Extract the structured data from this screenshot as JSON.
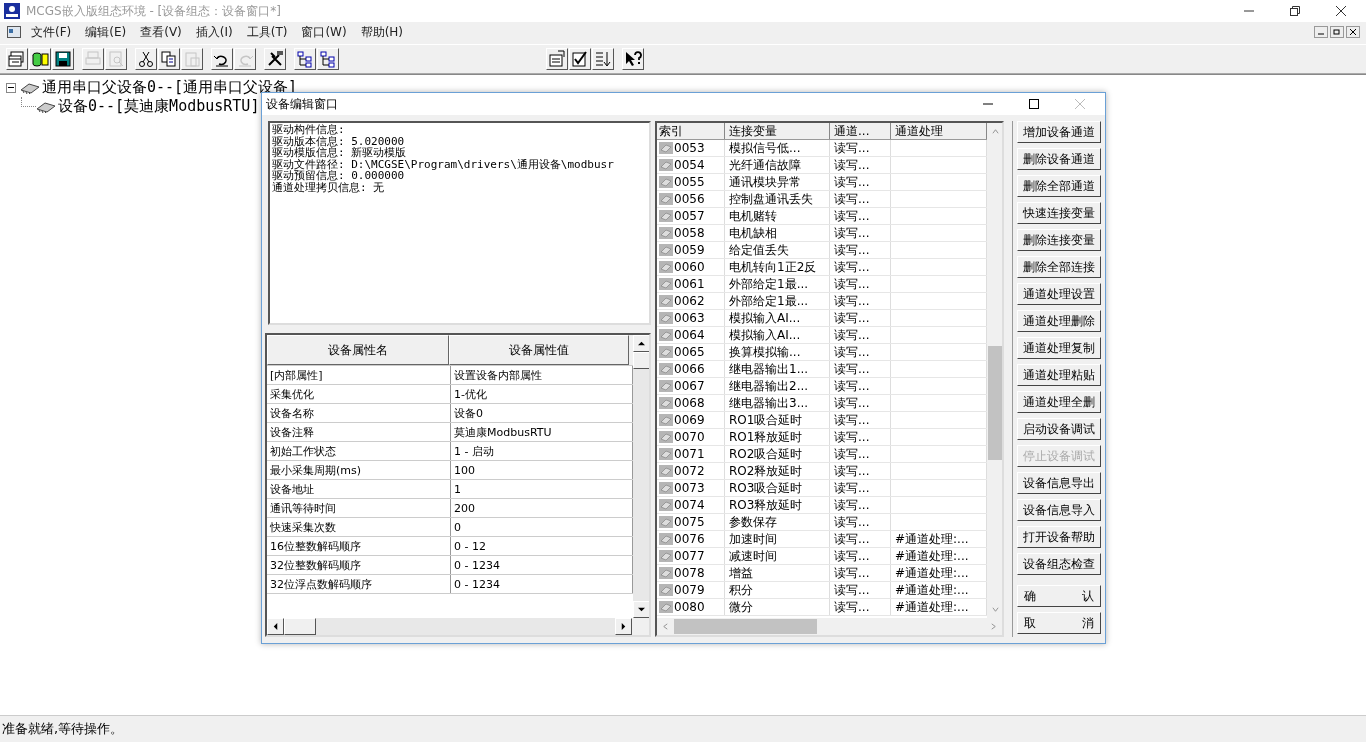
{
  "window": {
    "title": "MCGS嵌入版组态环境 - [设备组态：设备窗口*]"
  },
  "menu": [
    "文件(F)",
    "编辑(E)",
    "查看(V)",
    "插入(I)",
    "工具(T)",
    "窗口(W)",
    "帮助(H)"
  ],
  "toolbar_left": [
    [
      {
        "kind": "windows",
        "disabled": false
      },
      {
        "kind": "database",
        "disabled": false
      },
      {
        "kind": "save",
        "disabled": false
      }
    ],
    [
      {
        "kind": "print",
        "disabled": true
      },
      {
        "kind": "preview",
        "disabled": true
      }
    ],
    [
      {
        "kind": "cut",
        "disabled": false
      },
      {
        "kind": "copy",
        "disabled": false
      },
      {
        "kind": "paste",
        "disabled": true
      }
    ],
    [
      {
        "kind": "undo",
        "disabled": false
      },
      {
        "kind": "redo",
        "disabled": true
      }
    ],
    [
      {
        "kind": "tools",
        "disabled": false
      }
    ],
    [
      {
        "kind": "tree",
        "disabled": false
      },
      {
        "kind": "tree",
        "disabled": false
      }
    ]
  ],
  "toolbar_right": [
    [
      {
        "kind": "properties",
        "disabled": false
      },
      {
        "kind": "check",
        "disabled": false
      },
      {
        "kind": "sort",
        "disabled": false
      }
    ],
    [
      {
        "kind": "help",
        "disabled": false
      }
    ]
  ],
  "tree": {
    "label": "通用串口父设备0--[通用串口父设备]",
    "expanded": true,
    "children": [
      {
        "label": "设备0--[莫迪康ModbusRTU]"
      }
    ]
  },
  "dialog": {
    "title": "设备编辑窗口",
    "info_lines": [
      "驱动构件信息:",
      "驱动版本信息: 5.020000",
      "驱动模版信息: 新驱动模版",
      "驱动文件路径: D:\\MCGSE\\Program\\drivers\\通用设备\\modbusr",
      "驱动预留信息: 0.000000",
      "通道处理拷贝信息: 无"
    ],
    "properties": {
      "columns": [
        "设备属性名",
        "设备属性值"
      ],
      "rows": [
        {
          "name": "[内部属性]",
          "value": "设置设备内部属性"
        },
        {
          "name": "采集优化",
          "value": "1-优化"
        },
        {
          "name": "设备名称",
          "value": "设备0"
        },
        {
          "name": "设备注释",
          "value": "莫迪康ModbusRTU"
        },
        {
          "name": "初始工作状态",
          "value": "1 - 启动"
        },
        {
          "name": "最小采集周期(ms)",
          "value": "100"
        },
        {
          "name": "设备地址",
          "value": "1"
        },
        {
          "name": "通讯等待时间",
          "value": "200"
        },
        {
          "name": "快速采集次数",
          "value": "0"
        },
        {
          "name": "16位整数解码顺序",
          "value": "0 - 12"
        },
        {
          "name": "32位整数解码顺序",
          "value": "0 - 1234"
        },
        {
          "name": "32位浮点数解码顺序",
          "value": "0 - 1234"
        }
      ]
    },
    "channels": {
      "columns": [
        "索引",
        "连接变量",
        "通道...",
        "通道处理"
      ],
      "rows": [
        {
          "index": "0053",
          "variable": "模拟信号低...",
          "type": "读写...",
          "processing": ""
        },
        {
          "index": "0054",
          "variable": "光纤通信故障",
          "type": "读写...",
          "processing": ""
        },
        {
          "index": "0055",
          "variable": "通讯模块异常",
          "type": "读写...",
          "processing": ""
        },
        {
          "index": "0056",
          "variable": "控制盘通讯丢失",
          "type": "读写...",
          "processing": ""
        },
        {
          "index": "0057",
          "variable": "电机赌转",
          "type": "读写...",
          "processing": ""
        },
        {
          "index": "0058",
          "variable": "电机缺相",
          "type": "读写...",
          "processing": ""
        },
        {
          "index": "0059",
          "variable": "给定值丢失",
          "type": "读写...",
          "processing": ""
        },
        {
          "index": "0060",
          "variable": "电机转向1正2反",
          "type": "读写...",
          "processing": ""
        },
        {
          "index": "0061",
          "variable": "外部给定1最...",
          "type": "读写...",
          "processing": ""
        },
        {
          "index": "0062",
          "variable": "外部给定1最...",
          "type": "读写...",
          "processing": ""
        },
        {
          "index": "0063",
          "variable": "模拟输入AI...",
          "type": "读写...",
          "processing": ""
        },
        {
          "index": "0064",
          "variable": "模拟输入AI...",
          "type": "读写...",
          "processing": ""
        },
        {
          "index": "0065",
          "variable": "换算模拟输...",
          "type": "读写...",
          "processing": ""
        },
        {
          "index": "0066",
          "variable": "继电器输出1...",
          "type": "读写...",
          "processing": ""
        },
        {
          "index": "0067",
          "variable": "继电器输出2...",
          "type": "读写...",
          "processing": ""
        },
        {
          "index": "0068",
          "variable": "继电器输出3...",
          "type": "读写...",
          "processing": ""
        },
        {
          "index": "0069",
          "variable": "RO1吸合延时",
          "type": "读写...",
          "processing": ""
        },
        {
          "index": "0070",
          "variable": "RO1释放延时",
          "type": "读写...",
          "processing": ""
        },
        {
          "index": "0071",
          "variable": "RO2吸合延时",
          "type": "读写...",
          "processing": ""
        },
        {
          "index": "0072",
          "variable": "RO2释放延时",
          "type": "读写...",
          "processing": ""
        },
        {
          "index": "0073",
          "variable": "RO3吸合延时",
          "type": "读写...",
          "processing": ""
        },
        {
          "index": "0074",
          "variable": "RO3释放延时",
          "type": "读写...",
          "processing": ""
        },
        {
          "index": "0075",
          "variable": "参数保存",
          "type": "读写...",
          "processing": ""
        },
        {
          "index": "0076",
          "variable": "加速时间",
          "type": "读写...",
          "processing": "#通道处理:..."
        },
        {
          "index": "0077",
          "variable": "减速时间",
          "type": "读写...",
          "processing": "#通道处理:..."
        },
        {
          "index": "0078",
          "variable": "增益",
          "type": "读写...",
          "processing": "#通道处理:..."
        },
        {
          "index": "0079",
          "variable": "积分",
          "type": "读写...",
          "processing": "#通道处理:..."
        },
        {
          "index": "0080",
          "variable": "微分",
          "type": "读写...",
          "processing": "#通道处理:..."
        }
      ]
    },
    "buttons": [
      {
        "label": "增加设备通道",
        "disabled": false
      },
      {
        "label": "删除设备通道",
        "disabled": false
      },
      {
        "label": "删除全部通道",
        "disabled": false
      },
      {
        "label": "快速连接变量",
        "disabled": false
      },
      {
        "label": "删除连接变量",
        "disabled": false
      },
      {
        "label": "删除全部连接",
        "disabled": false
      },
      {
        "label": "通道处理设置",
        "disabled": false
      },
      {
        "label": "通道处理删除",
        "disabled": false
      },
      {
        "label": "通道处理复制",
        "disabled": false
      },
      {
        "label": "通道处理粘贴",
        "disabled": false
      },
      {
        "label": "通道处理全删",
        "disabled": false
      },
      {
        "label": "启动设备调试",
        "disabled": false
      },
      {
        "label": "停止设备调试",
        "disabled": true
      },
      {
        "label": "设备信息导出",
        "disabled": false
      },
      {
        "label": "设备信息导入",
        "disabled": false
      },
      {
        "label": "打开设备帮助",
        "disabled": false
      },
      {
        "label": "设备组态检查",
        "disabled": false
      }
    ],
    "dialog_buttons": [
      "确 认",
      "取 消"
    ]
  },
  "status_bar": "准备就绪,等待操作。"
}
